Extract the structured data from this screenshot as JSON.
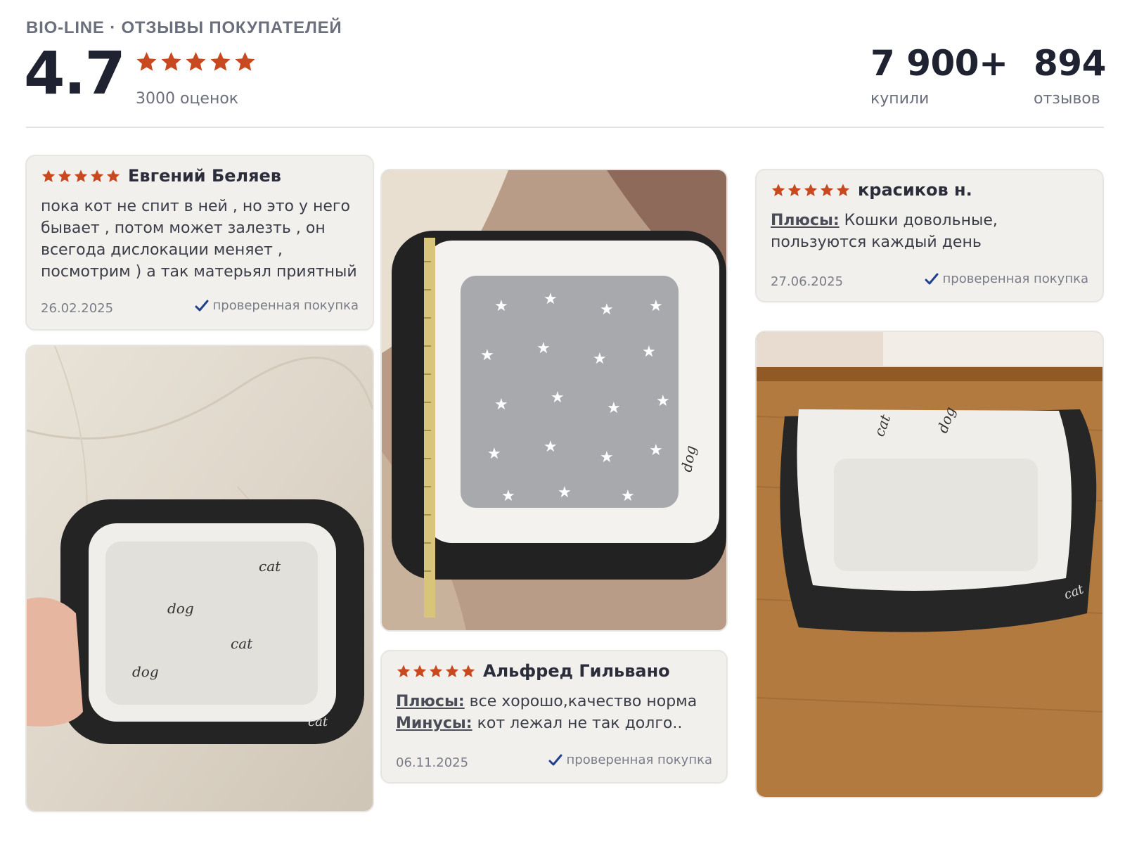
{
  "header": {
    "brand": "BIO-LINE · ОТЗЫВЫ ПОКУПАТЕЛЕЙ",
    "rating": "4.7",
    "rating_count": "3000 оценок",
    "stats": [
      {
        "value": "7 900+",
        "label": "купили"
      },
      {
        "value": "894",
        "label": "отзывов"
      }
    ]
  },
  "reviews": [
    {
      "name": "Евгений Беляев",
      "stars": 5,
      "text": "пока кот не спит в ней , но это у него бывает , потом может залезть , он всегода дислокации меняет , посмотрим ) а так матерьял приятный",
      "date": "26.02.2025",
      "verified": "проверенная покупка"
    },
    {
      "name": "красиков н.",
      "stars": 5,
      "pros_label": "Плюсы:",
      "pros": "Кошки довольные, пользуются каждый день",
      "date": "27.06.2025",
      "verified": "проверенная покупка"
    },
    {
      "name": "Альфред Гильвано",
      "stars": 5,
      "pros_label": "Плюсы:",
      "pros": "все хорошо,качество норма",
      "cons_label": "Минусы:",
      "cons": "кот лежал не так долго..",
      "date": "06.11.2025",
      "verified": "проверенная покупка"
    }
  ],
  "photos": [
    {
      "bed_text": [
        "cat",
        "dog",
        "cat",
        "dog"
      ]
    },
    {
      "bed_text": [
        "dog"
      ]
    },
    {
      "bed_text": [
        "cat",
        "dog",
        "cat"
      ]
    }
  ],
  "colors": {
    "star": "#c8491f",
    "check": "#1f3f8f",
    "card_bg": "#f1f0ed"
  }
}
